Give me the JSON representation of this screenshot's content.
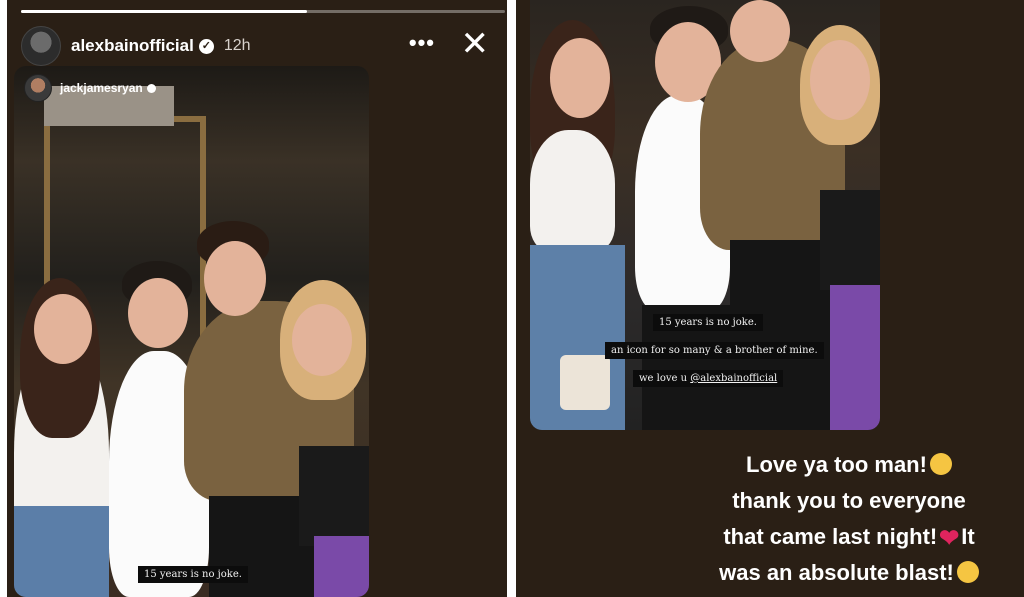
{
  "story": {
    "username": "alexbainofficial",
    "time": "12h",
    "more_glyph": "•••",
    "close_glyph": "✕",
    "progress_fraction": 0.59
  },
  "repost": {
    "username": "jackjamesryan"
  },
  "left_caption": "15 years is no joke.",
  "right_captions": [
    "15 years is no joke.",
    "an icon for so many & a brother of mine.",
    "we love u",
    "@alexbainofficial"
  ],
  "reply_lines": [
    "Love ya too man!",
    "thank you to everyone",
    "that came last night!",
    "It",
    "was an absolute blast!"
  ],
  "icons": {
    "verified": "verified-badge-icon",
    "pleading": "pleading-face-emoji",
    "heart": "red-heart-emoji",
    "smiling": "smiling-face-emoji"
  },
  "colors": {
    "story_bg": "#2a1f15",
    "heart": "#e0245e",
    "emoji": "#f5c542"
  }
}
